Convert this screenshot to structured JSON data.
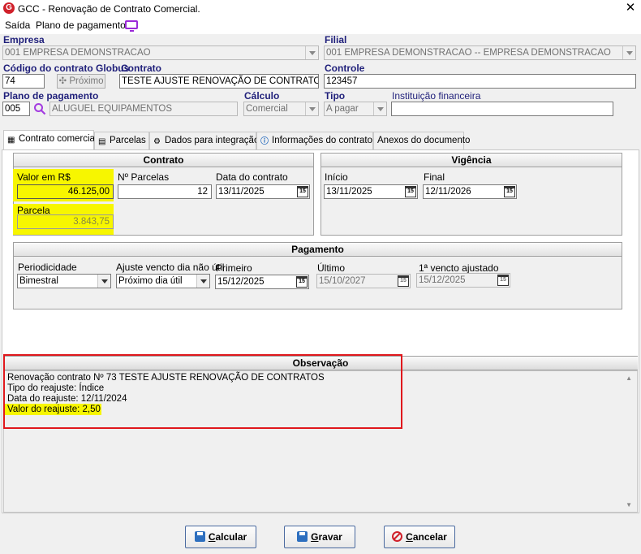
{
  "window": {
    "title": "GCC - Renovação de Contrato Comercial.",
    "logo": "G"
  },
  "menu": {
    "exit": "Saída",
    "payment_plan": "Plano de pagamento"
  },
  "header": {
    "empresa_label": "Empresa",
    "empresa_value": "001 EMPRESA DEMONSTRACAO",
    "filial_label": "Filial",
    "filial_value": "001 EMPRESA DEMONSTRACAO -- EMPRESA DEMONSTRACAO",
    "codigo_label": "Código do contrato Globus",
    "codigo_value": "74",
    "proximo_label": "✣ Próximo",
    "contrato_label": "Contrato",
    "contrato_value": "TESTE AJUSTE RENOVAÇÃO DE CONTRATOS",
    "controle_label": "Controle",
    "controle_value": "123457",
    "plano_label": "Plano de pagamento",
    "plano_code": "005",
    "plano_value": "ALUGUEL EQUIPAMENTOS",
    "calculo_label": "Cálculo",
    "calculo_value": "Comercial",
    "tipo_label": "Tipo",
    "tipo_value": "A pagar",
    "instituicao_label": "Instituição financeira",
    "instituicao_value": ""
  },
  "tabs": [
    {
      "label": "Contrato comercial"
    },
    {
      "label": "Parcelas"
    },
    {
      "label": "Dados para integração"
    },
    {
      "label": "Informações do contrato"
    },
    {
      "label": "Anexos do documento"
    }
  ],
  "contrato_group": {
    "title": "Contrato",
    "valor_label": "Valor em R$",
    "valor_value": "46.125,00",
    "parcelas_label": "Nº Parcelas",
    "parcelas_value": "12",
    "data_label": "Data do contrato",
    "data_value": "13/11/2025",
    "parcela_label": "Parcela",
    "parcela_value": "3.843,75"
  },
  "vigencia_group": {
    "title": "Vigência",
    "inicio_label": "Início",
    "inicio_value": "13/11/2025",
    "final_label": "Final",
    "final_value": "12/11/2026"
  },
  "pagamento_group": {
    "title": "Pagamento",
    "periodicidade_label": "Periodicidade",
    "periodicidade_value": "Bimestral",
    "ajuste_label": "Ajuste vencto dia não útil",
    "ajuste_value": "Próximo dia útil",
    "primeiro_label": "Primeiro",
    "primeiro_value": "15/12/2025",
    "ultimo_label": "Último",
    "ultimo_value": "15/10/2027",
    "vencto_label": "1ª vencto ajustado",
    "vencto_value": "15/12/2025"
  },
  "observacao": {
    "title": "Observação",
    "lines": [
      "Renovação contrato Nº 73 TESTE AJUSTE RENOVAÇÃO DE CONTRATOS",
      "Tipo do reajuste: Índice",
      "Data do reajuste: 12/11/2024",
      "Valor do reajuste: 2,50"
    ]
  },
  "buttons": {
    "calcular_hot": "C",
    "calcular_rest": "alcular",
    "gravar_hot": "G",
    "gravar_rest": "ravar",
    "cancelar_hot": "C",
    "cancelar_rest": "ancelar"
  },
  "colors": {
    "highlight": "#f7f600",
    "annotation_red": "#e0181d",
    "label_blue": "#1f1f7a"
  }
}
